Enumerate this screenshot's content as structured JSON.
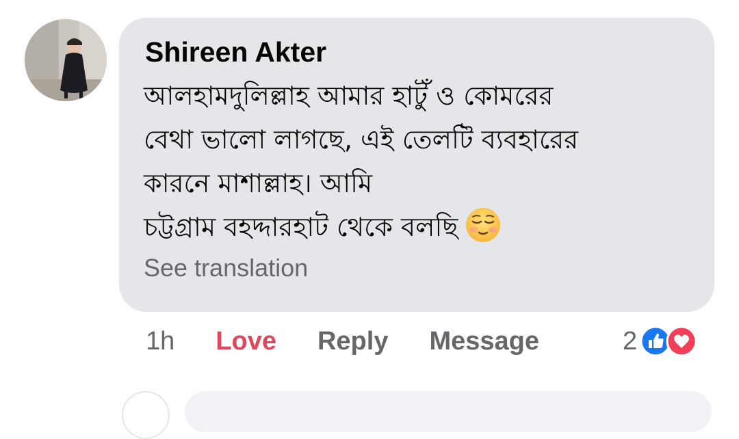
{
  "comment": {
    "author": "Shireen Akter",
    "lines": [
      "আলহামদুলিল্লাহ আমার হাটুঁ ও কোমরের",
      "বেথা ভালো লাগছে, এই তেলটি ব্যবহারের",
      "কারনে মাশাল্লাহ। আমি",
      "চট্টগ্রাম বহদ্দারহাট থেকে বলছি"
    ],
    "emoji": "relieved-face-emoji",
    "see_translation": "See translation"
  },
  "actions": {
    "time": "1h",
    "love": "Love",
    "reply": "Reply",
    "message": "Message"
  },
  "reactions": {
    "count": "2",
    "types": [
      "like-icon",
      "love-icon"
    ]
  },
  "colors": {
    "bubble": "#e4e6e9",
    "love_text": "#e0475b",
    "muted_text": "#65676b",
    "like_blue": "#1877f2",
    "love_red": "#f33e58"
  }
}
